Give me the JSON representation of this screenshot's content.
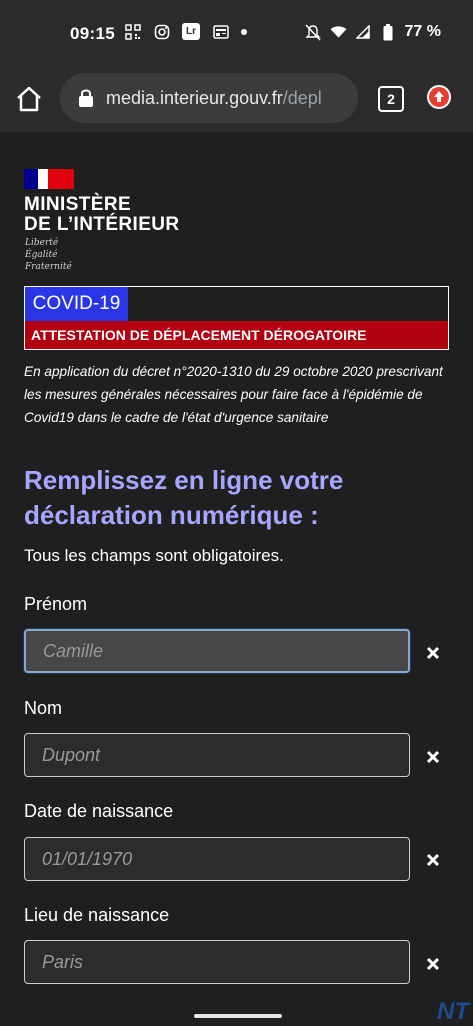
{
  "status_bar": {
    "time": "09:15",
    "left_icons": [
      "qr-code-icon",
      "instagram-icon",
      "lightroom-icon",
      "news-icon",
      "notification-dot"
    ],
    "lightroom_label": "Lr",
    "right_icons": [
      "mute-icon",
      "wifi-icon",
      "signal-icon",
      "battery-icon"
    ],
    "battery": "77 %"
  },
  "browser": {
    "url_domain": "media.interieur.gouv.fr",
    "url_path": "/depl",
    "tab_count": "2"
  },
  "header": {
    "ministere_line1": "MINISTÈRE",
    "ministere_line2": "DE L’INTÉRIEUR",
    "devise_1": "Liberté",
    "devise_2": "Égalité",
    "devise_3": "Fraternité"
  },
  "covid": {
    "tag": "COVID-19",
    "banner": "ATTESTATION DE DÉPLACEMENT DÉROGATOIRE"
  },
  "decret": "En application du décret n°2020-1310 du 29 octobre 2020 prescrivant les mesures générales nécessaires pour faire face à l'épidémie de Covid19 dans le cadre de l'état d'urgence sanitaire",
  "form": {
    "heading": "Remplissez en ligne votre déclaration numérique :",
    "mandatory_note": "Tous les champs sont obligatoires.",
    "fields": [
      {
        "label": "Prénom",
        "placeholder": "Camille",
        "value": ""
      },
      {
        "label": "Nom",
        "placeholder": "Dupont",
        "value": ""
      },
      {
        "label": "Date de naissance",
        "placeholder": "01/01/1970",
        "value": ""
      },
      {
        "label": "Lieu de naissance",
        "placeholder": "Paris",
        "value": ""
      }
    ]
  },
  "watermark": "NT"
}
